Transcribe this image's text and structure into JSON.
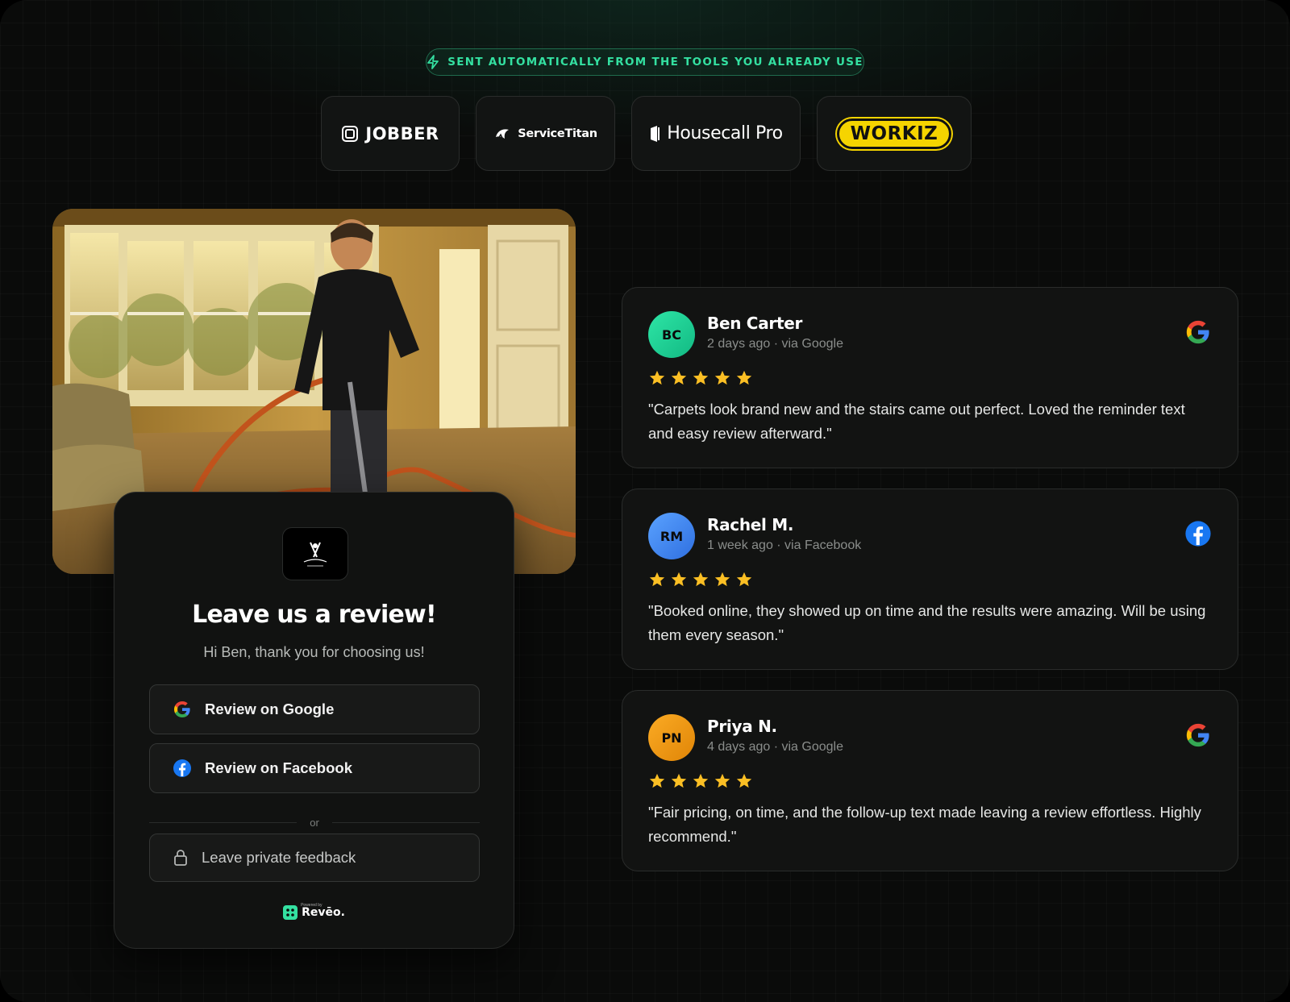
{
  "banner": {
    "label": "SENT AUTOMATICALLY FROM THE TOOLS YOU ALREADY USE",
    "accent": "#34e0a1"
  },
  "integrations": [
    {
      "name": "JOBBER",
      "icon": "jobber-logo-icon"
    },
    {
      "name": "ServiceTitan",
      "icon": "servicetitan-logo-icon"
    },
    {
      "name": "Housecall Pro",
      "icon": "housecall-pro-logo-icon"
    },
    {
      "name": "WORKIZ",
      "icon": "workiz-logo-icon"
    }
  ],
  "review_form": {
    "title": "Leave us a review!",
    "subtitle": "Hi Ben, thank you for choosing us!",
    "google_button": "Review on Google",
    "facebook_button": "Review on Facebook",
    "divider_text": "or",
    "private_button": "Leave private feedback",
    "powered_by": "Powered by",
    "brand": "Revēo."
  },
  "reviews": [
    {
      "initials": "BC",
      "name": "Ben Carter",
      "meta": "2 days ago · via Google",
      "platform": "google",
      "rating": 5,
      "text": "\"Carpets look brand new and the stairs came out perfect. Loved the reminder text and easy review afterward.\"",
      "avatar_color": "#22d39a"
    },
    {
      "initials": "RM",
      "name": "Rachel M.",
      "meta": "1 week ago · via Facebook",
      "platform": "facebook",
      "rating": 5,
      "text": "\"Booked online, they showed up on time and the results were amazing. Will be using them every season.\"",
      "avatar_color": "#3b82f6"
    },
    {
      "initials": "PN",
      "name": "Priya N.",
      "meta": "4 days ago · via Google",
      "platform": "google",
      "rating": 5,
      "text": "\"Fair pricing, on time, and the follow-up text made leaving a review effortless. Highly recommend.\"",
      "avatar_color": "#f59e0b"
    }
  ],
  "colors": {
    "star": "#fbbf24",
    "google_blue": "#4285F4",
    "facebook_blue": "#1877F2"
  }
}
